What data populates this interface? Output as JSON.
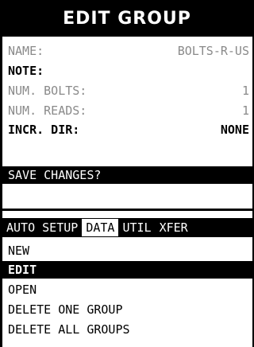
{
  "title": "EDIT GROUP",
  "fields": [
    {
      "label": "NAME:",
      "value": "BOLTS-R-US",
      "style": "dim"
    },
    {
      "label": "NOTE:",
      "value": "",
      "style": "bold"
    },
    {
      "label": "NUM. BOLTS:",
      "value": "1",
      "style": "dim"
    },
    {
      "label": "NUM. READS:",
      "value": "1",
      "style": "dim"
    },
    {
      "label": "INCR. DIR:",
      "value": "NONE",
      "style": "bold"
    }
  ],
  "save_prompt": "SAVE CHANGES?",
  "tabs": [
    {
      "label": "AUTO SETUP",
      "active": false
    },
    {
      "label": "DATA",
      "active": true
    },
    {
      "label": "UTIL",
      "active": false
    },
    {
      "label": "XFER",
      "active": false
    }
  ],
  "menu_items": [
    {
      "label": "NEW",
      "selected": false
    },
    {
      "label": "EDIT",
      "selected": true
    },
    {
      "label": "OPEN",
      "selected": false
    },
    {
      "label": "DELETE ONE GROUP",
      "selected": false
    },
    {
      "label": "DELETE ALL GROUPS",
      "selected": false
    }
  ]
}
